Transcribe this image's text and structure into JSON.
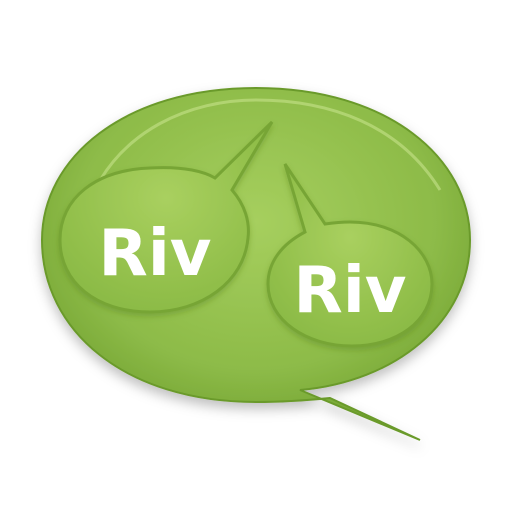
{
  "app_icon": {
    "bubble_left_label": "Riv",
    "bubble_right_label": "Riv",
    "colors": {
      "outer_bubble": "#8dbb48",
      "outer_bubble_highlight": "#bcdc78",
      "outer_bubble_shadow": "#6a9a2c",
      "inner_bubble": "#9cc653",
      "inner_bubble_rim": "#77a536",
      "label": "#ffffff"
    }
  }
}
